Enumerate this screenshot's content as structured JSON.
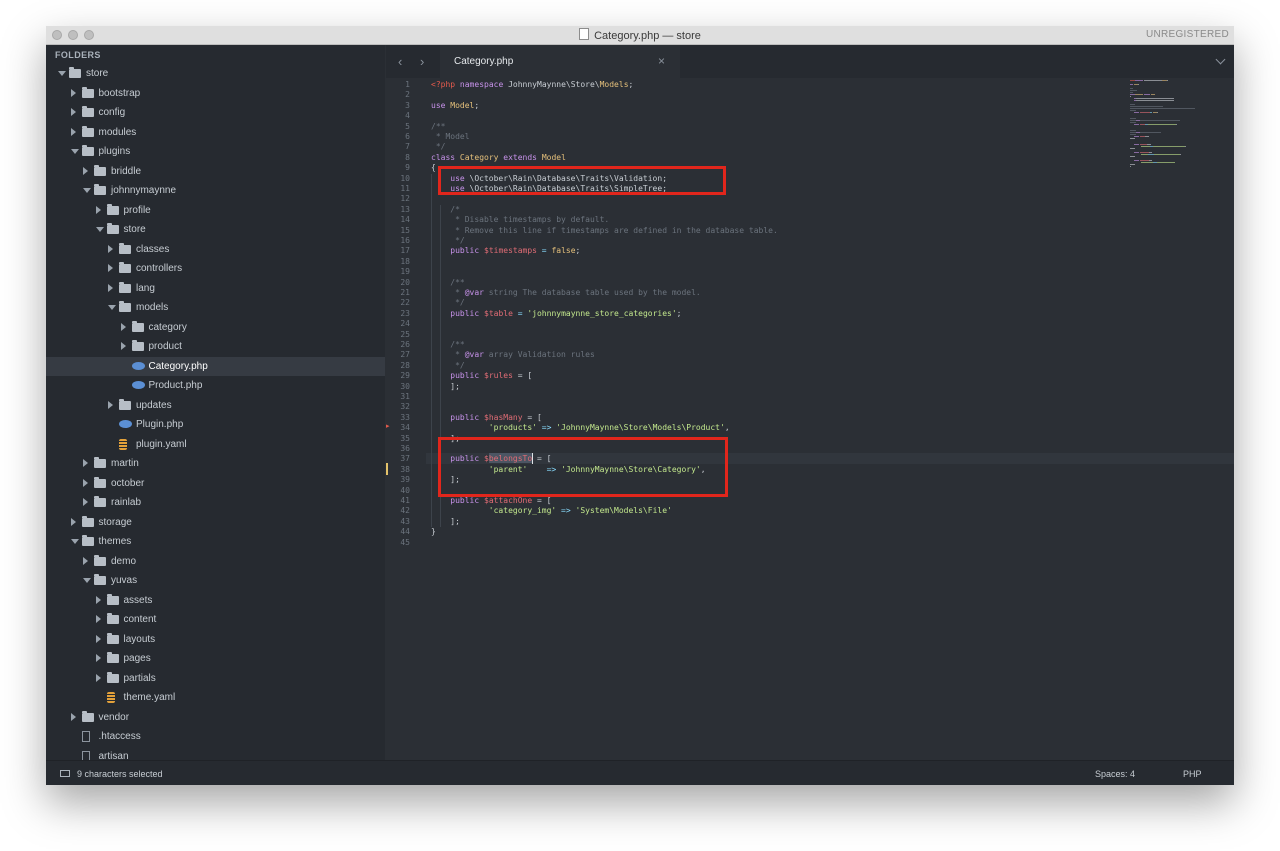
{
  "window": {
    "title": "Category.php — store",
    "unregistered": "UNREGISTERED"
  },
  "sidebar": {
    "header": "FOLDERS",
    "tree": [
      {
        "label": "store",
        "depth": 0,
        "type": "folder",
        "state": "open"
      },
      {
        "label": "bootstrap",
        "depth": 1,
        "type": "folder",
        "state": "closed"
      },
      {
        "label": "config",
        "depth": 1,
        "type": "folder",
        "state": "closed"
      },
      {
        "label": "modules",
        "depth": 1,
        "type": "folder",
        "state": "closed"
      },
      {
        "label": "plugins",
        "depth": 1,
        "type": "folder",
        "state": "open"
      },
      {
        "label": "briddle",
        "depth": 2,
        "type": "folder",
        "state": "closed"
      },
      {
        "label": "johnnymaynne",
        "depth": 2,
        "type": "folder",
        "state": "open"
      },
      {
        "label": "profile",
        "depth": 3,
        "type": "folder",
        "state": "closed"
      },
      {
        "label": "store",
        "depth": 3,
        "type": "folder",
        "state": "open"
      },
      {
        "label": "classes",
        "depth": 4,
        "type": "folder",
        "state": "closed"
      },
      {
        "label": "controllers",
        "depth": 4,
        "type": "folder",
        "state": "closed"
      },
      {
        "label": "lang",
        "depth": 4,
        "type": "folder",
        "state": "closed"
      },
      {
        "label": "models",
        "depth": 4,
        "type": "folder",
        "state": "open"
      },
      {
        "label": "category",
        "depth": 5,
        "type": "folder",
        "state": "closed"
      },
      {
        "label": "product",
        "depth": 5,
        "type": "folder",
        "state": "closed"
      },
      {
        "label": "Category.php",
        "depth": 5,
        "type": "php",
        "state": "selected"
      },
      {
        "label": "Product.php",
        "depth": 5,
        "type": "php",
        "state": "none"
      },
      {
        "label": "updates",
        "depth": 4,
        "type": "folder",
        "state": "closed"
      },
      {
        "label": "Plugin.php",
        "depth": 4,
        "type": "php",
        "state": "none"
      },
      {
        "label": "plugin.yaml",
        "depth": 4,
        "type": "yaml",
        "state": "none"
      },
      {
        "label": "martin",
        "depth": 2,
        "type": "folder",
        "state": "closed"
      },
      {
        "label": "october",
        "depth": 2,
        "type": "folder",
        "state": "closed"
      },
      {
        "label": "rainlab",
        "depth": 2,
        "type": "folder",
        "state": "closed"
      },
      {
        "label": "storage",
        "depth": 1,
        "type": "folder",
        "state": "closed"
      },
      {
        "label": "themes",
        "depth": 1,
        "type": "folder",
        "state": "open"
      },
      {
        "label": "demo",
        "depth": 2,
        "type": "folder",
        "state": "closed"
      },
      {
        "label": "yuvas",
        "depth": 2,
        "type": "folder",
        "state": "open"
      },
      {
        "label": "assets",
        "depth": 3,
        "type": "folder",
        "state": "closed"
      },
      {
        "label": "content",
        "depth": 3,
        "type": "folder",
        "state": "closed"
      },
      {
        "label": "layouts",
        "depth": 3,
        "type": "folder",
        "state": "closed"
      },
      {
        "label": "pages",
        "depth": 3,
        "type": "folder",
        "state": "closed"
      },
      {
        "label": "partials",
        "depth": 3,
        "type": "folder",
        "state": "closed"
      },
      {
        "label": "theme.yaml",
        "depth": 3,
        "type": "yaml",
        "state": "none"
      },
      {
        "label": "vendor",
        "depth": 1,
        "type": "folder",
        "state": "closed"
      },
      {
        "label": ".htaccess",
        "depth": 1,
        "type": "file",
        "state": "none"
      },
      {
        "label": "artisan",
        "depth": 1,
        "type": "file",
        "state": "none"
      }
    ]
  },
  "tabs": {
    "back_glyph": "‹",
    "forward_glyph": "›",
    "active": "Category.php",
    "close_glyph": "×"
  },
  "editor": {
    "current_line": 37,
    "lines": [
      [
        [
          "<?php",
          "red"
        ],
        [
          " ",
          "ns"
        ],
        [
          "namespace",
          "kw"
        ],
        [
          " JohnnyMaynne\\Store\\",
          "ns"
        ],
        [
          "Models",
          "cls"
        ],
        [
          ";",
          "ns"
        ]
      ],
      [],
      [
        [
          "use",
          "kw"
        ],
        [
          " ",
          "ns"
        ],
        [
          "Model",
          "cls"
        ],
        [
          ";",
          "ns"
        ]
      ],
      [],
      [
        [
          "/**",
          "cm"
        ]
      ],
      [
        [
          " * Model",
          "cm"
        ]
      ],
      [
        [
          " */",
          "cm"
        ]
      ],
      [
        [
          "class",
          "kw"
        ],
        [
          " ",
          "ns"
        ],
        [
          "Category",
          "cls"
        ],
        [
          " ",
          "ns"
        ],
        [
          "extends",
          "kw"
        ],
        [
          " ",
          "ns"
        ],
        [
          "Model",
          "cls"
        ]
      ],
      [
        [
          "{",
          "ns"
        ]
      ],
      [
        [
          "    ",
          "ns"
        ],
        [
          "use",
          "kw"
        ],
        [
          " \\October\\Rain\\Database\\Traits\\Validation;",
          "ns"
        ]
      ],
      [
        [
          "    ",
          "ns"
        ],
        [
          "use",
          "kw"
        ],
        [
          " \\October\\Rain\\Database\\Traits\\SimpleTree;",
          "ns"
        ]
      ],
      [],
      [
        [
          "    /*",
          "cm"
        ]
      ],
      [
        [
          "     * Disable timestamps by default.",
          "cm"
        ]
      ],
      [
        [
          "     * Remove this line if timestamps are defined in the database table.",
          "cm"
        ]
      ],
      [
        [
          "     */",
          "cm"
        ]
      ],
      [
        [
          "    ",
          "ns"
        ],
        [
          "public",
          "kw"
        ],
        [
          " ",
          "ns"
        ],
        [
          "$timestamps",
          "var"
        ],
        [
          " = ",
          "op"
        ],
        [
          "false",
          "cls"
        ],
        [
          ";",
          "ns"
        ]
      ],
      [],
      [],
      [
        [
          "    /**",
          "cm"
        ]
      ],
      [
        [
          "     * ",
          "cm"
        ],
        [
          "@var",
          "kw"
        ],
        [
          " string The database table used by the model.",
          "cm"
        ]
      ],
      [
        [
          "     */",
          "cm"
        ]
      ],
      [
        [
          "    ",
          "ns"
        ],
        [
          "public",
          "kw"
        ],
        [
          " ",
          "ns"
        ],
        [
          "$table",
          "var"
        ],
        [
          " = ",
          "op"
        ],
        [
          "'johnnymaynne_store_categories'",
          "str"
        ],
        [
          ";",
          "ns"
        ]
      ],
      [],
      [],
      [
        [
          "    /**",
          "cm"
        ]
      ],
      [
        [
          "     * ",
          "cm"
        ],
        [
          "@var",
          "kw"
        ],
        [
          " array Validation rules",
          "cm"
        ]
      ],
      [
        [
          "     */",
          "cm"
        ]
      ],
      [
        [
          "    ",
          "ns"
        ],
        [
          "public",
          "kw"
        ],
        [
          " ",
          "ns"
        ],
        [
          "$rules",
          "var"
        ],
        [
          " = [",
          "ns"
        ]
      ],
      [
        [
          "    ];",
          "ns"
        ]
      ],
      [],
      [],
      [
        [
          "    ",
          "ns"
        ],
        [
          "public",
          "kw"
        ],
        [
          " ",
          "ns"
        ],
        [
          "$hasMany",
          "var"
        ],
        [
          " = [",
          "ns"
        ]
      ],
      [
        [
          "            ",
          "ns"
        ],
        [
          "'products'",
          "str"
        ],
        [
          " => ",
          "op"
        ],
        [
          "'JohnnyMaynne\\Store\\Models\\Product'",
          "str"
        ],
        [
          ",",
          "ns"
        ]
      ],
      [
        [
          "    ];",
          "ns"
        ]
      ],
      [],
      [
        [
          "    ",
          "ns"
        ],
        [
          "public",
          "kw"
        ],
        [
          " ",
          "ns"
        ],
        [
          "$belongsTo",
          "var"
        ],
        [
          " = [",
          "ns"
        ]
      ],
      [
        [
          "            ",
          "ns"
        ],
        [
          "'parent'",
          "str"
        ],
        [
          "    => ",
          "op"
        ],
        [
          "'JohnnyMaynne\\Store\\Category'",
          "str"
        ],
        [
          ",",
          "ns"
        ]
      ],
      [
        [
          "    ];",
          "ns"
        ]
      ],
      [],
      [
        [
          "    ",
          "ns"
        ],
        [
          "public",
          "kw"
        ],
        [
          " ",
          "ns"
        ],
        [
          "$attachOne",
          "var"
        ],
        [
          " = [",
          "ns"
        ]
      ],
      [
        [
          "            ",
          "ns"
        ],
        [
          "'category_img'",
          "str"
        ],
        [
          " => ",
          "op"
        ],
        [
          "'System\\Models\\File'",
          "str"
        ]
      ],
      [
        [
          "    ];",
          "ns"
        ]
      ],
      [
        [
          "}",
          "ns"
        ]
      ],
      []
    ]
  },
  "colors": {
    "red": "#e55b4d",
    "kw": "#c792ea",
    "var": "#e06c75",
    "str": "#c3e88d",
    "cls": "#e5c07b",
    "cm": "#6b737d",
    "op": "#89ddff",
    "ns": "#c9ced4",
    "highlight_box": "#e1261c"
  },
  "status": {
    "selection": "9 characters selected",
    "indent": "Spaces: 4",
    "syntax": "PHP"
  }
}
